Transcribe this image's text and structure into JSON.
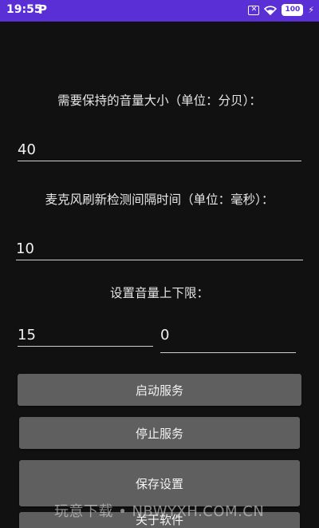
{
  "statusbar": {
    "time": "19:55",
    "app_icon": "P",
    "notif_icon": "x-box-icon",
    "battery": "100",
    "bolt": "⚡"
  },
  "form": {
    "volume_label": "需要保持的音量大小（单位：分贝）：",
    "volume_value": "40",
    "interval_label": "麦克风刷新检测间隔时间（单位：毫秒）：",
    "interval_value": "10",
    "limits_label": "设置音量上下限：",
    "upper_value": "15",
    "lower_value": "0"
  },
  "buttons": {
    "start": "启动服务",
    "stop": "停止服务",
    "save": "保存设置",
    "about": "关于软件"
  },
  "watermark": "玩意下载 • NBWYXH.COM.CN"
}
